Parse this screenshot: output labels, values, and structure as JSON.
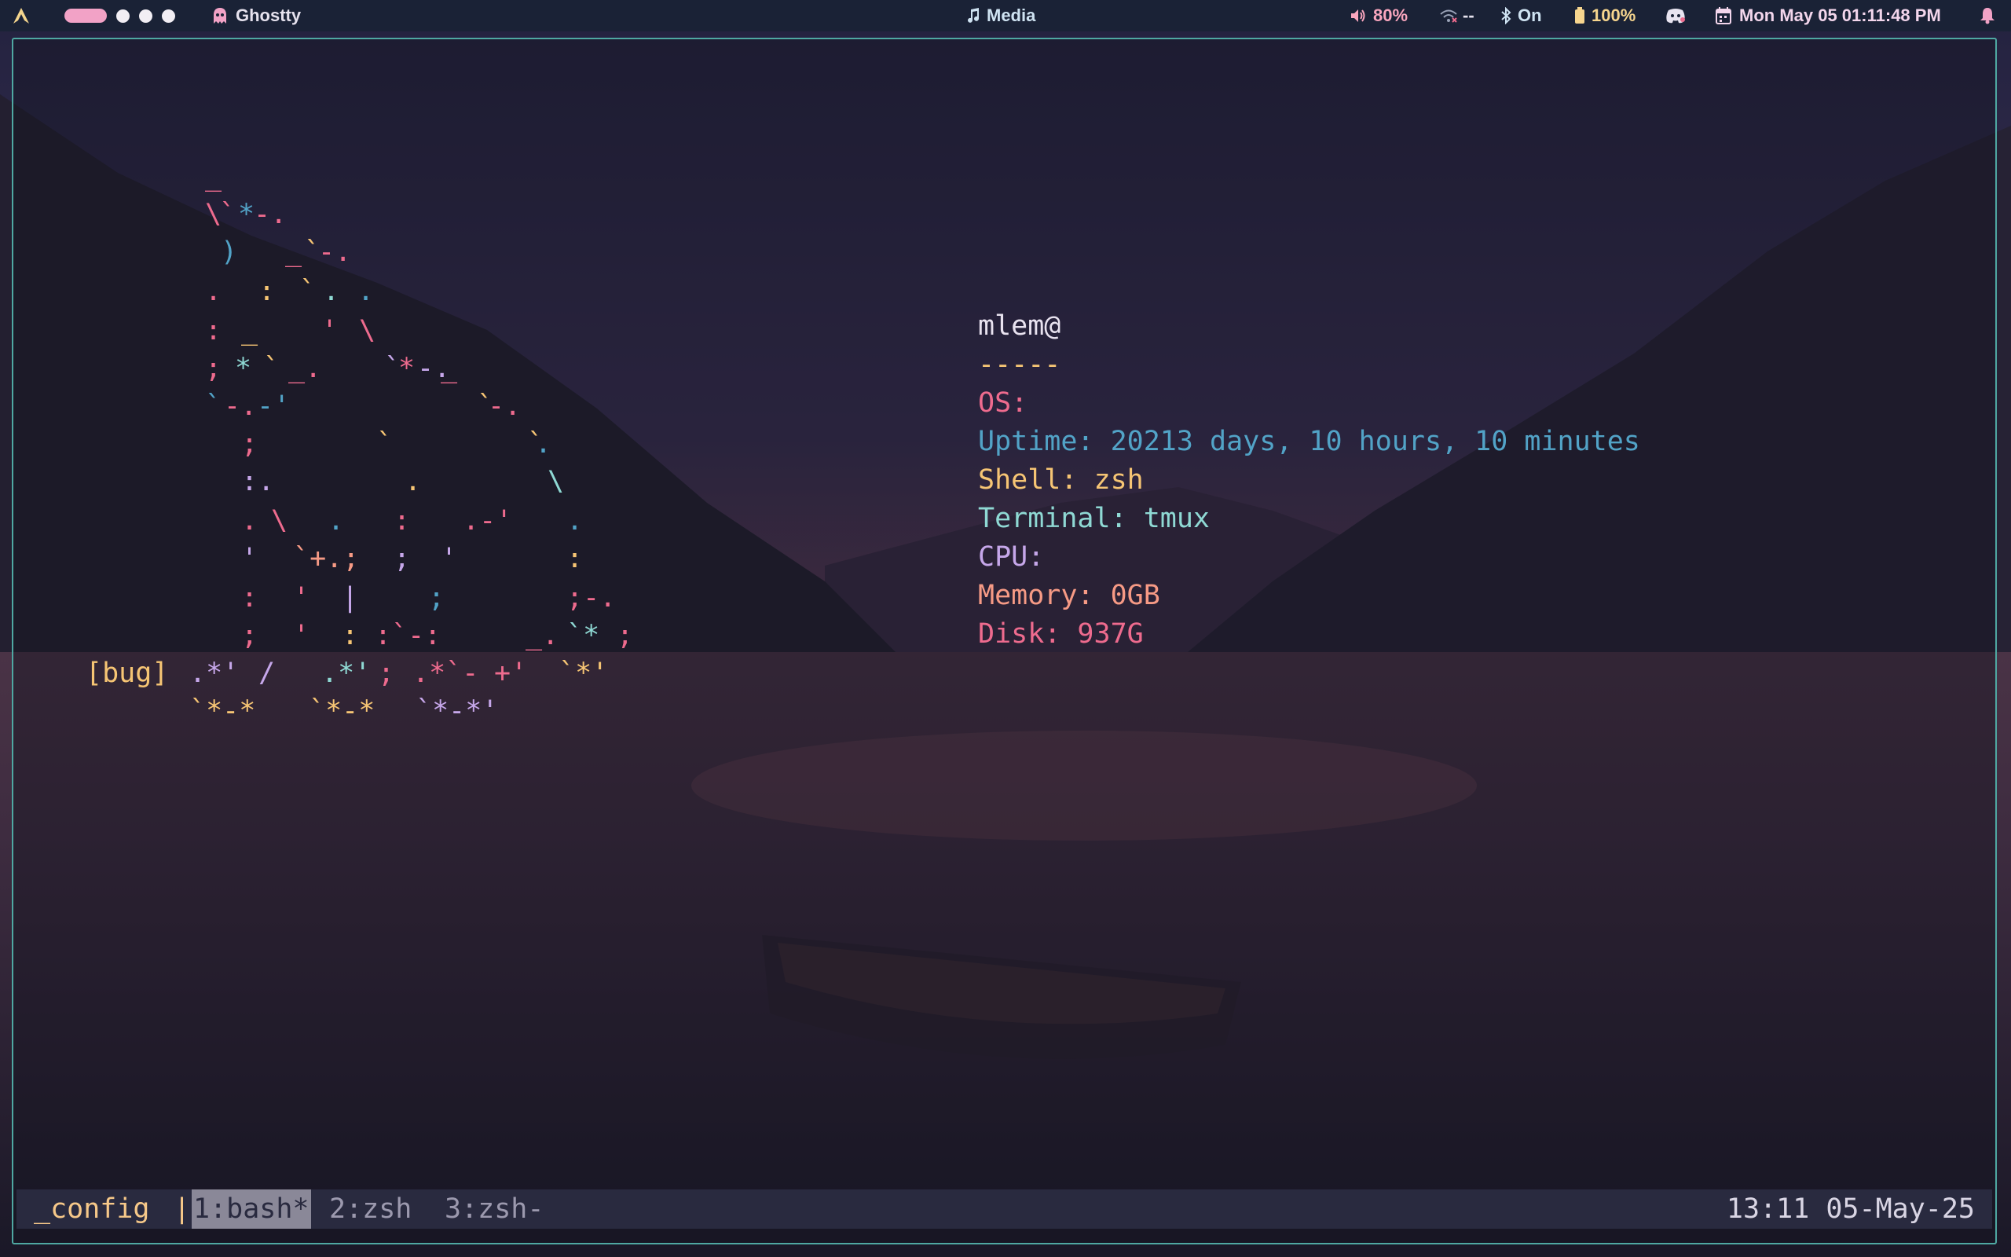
{
  "colors": {
    "accent_border": "#4fa8a2",
    "pink": "#ee6b8e",
    "cyan": "#52a3c7",
    "yellow": "#f6c574",
    "teal": "#8fd9d4",
    "lavender": "#c6a7ea",
    "peach": "#f69a85",
    "ws_active": "#f2a2c6"
  },
  "topbar": {
    "arch_icon": "arch-linux-icon",
    "window_title": "Ghostty",
    "window_icon": "ghost-icon",
    "media_label": "Media",
    "media_icon": "music-note-icon",
    "volume": "80%",
    "volume_icon": "speaker-icon",
    "network": "--",
    "network_icon": "wifi-off-icon",
    "bluetooth": "On",
    "bluetooth_icon": "bluetooth-icon",
    "battery": "100%",
    "battery_icon": "battery-icon",
    "discord_icon": "discord-icon",
    "datetime": "Mon May 05  01:11:48 PM",
    "calendar_icon": "calendar-icon",
    "bell_icon": "bell-icon"
  },
  "neofetch": {
    "user_host": "mlem@",
    "separator": "-----",
    "os": "OS:",
    "uptime": "Uptime: 20213 days, 10 hours, 10 minutes",
    "shell": "Shell: zsh",
    "terminal": "Terminal: tmux",
    "cpu": "CPU:",
    "memory": "Memory: 0GB",
    "disk": "Disk: 937G"
  },
  "ascii_art": [
    {
      "t": "_",
      "c": "pink"
    },
    {
      "t": "\\",
      "c": "pink"
    },
    {
      "t": "`",
      "c": "pink"
    },
    {
      "t": "*",
      "c": "cyan"
    },
    {
      "t": "-.",
      "c": "pink"
    },
    {
      "t": ")",
      "c": "cyan"
    },
    {
      "t": "_",
      "c": "pink"
    },
    {
      "t": "`",
      "c": "yellow"
    },
    {
      "t": "-.",
      "c": "pink"
    },
    {
      "t": ".",
      "c": "pink"
    },
    {
      "t": ":",
      "c": "yellow"
    },
    {
      "t": "`",
      "c": "yellow"
    },
    {
      "t": ".",
      "c": "teal"
    },
    {
      "t": ".",
      "c": "cyan"
    },
    {
      "t": ":",
      "c": "pink"
    },
    {
      "t": "_",
      "c": "yellow"
    },
    {
      "t": "'",
      "c": "pink"
    },
    {
      "t": "\\",
      "c": "pink"
    },
    {
      "t": ";",
      "c": "pink"
    },
    {
      "t": "*",
      "c": "teal"
    },
    {
      "t": "`",
      "c": "yellow"
    },
    {
      "t": "_.",
      "c": "pink"
    },
    {
      "t": "`",
      "c": "lavender"
    },
    {
      "t": "*",
      "c": "pink"
    },
    {
      "t": "-.",
      "c": "lavender"
    },
    {
      "t": "_",
      "c": "pink"
    },
    {
      "t": "`",
      "c": "cyan"
    },
    {
      "t": "-.",
      "c": "pink"
    },
    {
      "t": "-'",
      "c": "cyan"
    },
    {
      "t": "`",
      "c": "yellow"
    },
    {
      "t": "-.",
      "c": "pink"
    },
    {
      "t": ";",
      "c": "pink"
    },
    {
      "t": "`",
      "c": "yellow"
    },
    {
      "t": "`",
      "c": "yellow"
    },
    {
      "t": ".",
      "c": "cyan"
    },
    {
      "t": ":.",
      "c": "lavender"
    },
    {
      "t": ".",
      "c": "yellow"
    },
    {
      "t": "\\",
      "c": "teal"
    },
    {
      "t": ".",
      "c": "pink"
    },
    {
      "t": "\\",
      "c": "pink"
    },
    {
      "t": ".",
      "c": "cyan"
    },
    {
      "t": ":",
      "c": "pink"
    },
    {
      "t": ".-'",
      "c": "pink"
    },
    {
      "t": ".",
      "c": "cyan"
    },
    {
      "t": "'",
      "c": "lavender"
    },
    {
      "t": "`+.;",
      "c": "peach"
    },
    {
      "t": ";",
      "c": "lavender"
    },
    {
      "t": "'",
      "c": "lavender"
    },
    {
      "t": ":",
      "c": "yellow"
    },
    {
      "t": ":",
      "c": "pink"
    },
    {
      "t": "'",
      "c": "pink"
    },
    {
      "t": "|",
      "c": "lavender"
    },
    {
      "t": ";",
      "c": "cyan"
    },
    {
      "t": ";-.",
      "c": "pink"
    },
    {
      "t": ";",
      "c": "pink"
    },
    {
      "t": "'",
      "c": "pink"
    },
    {
      "t": ":",
      "c": "yellow"
    },
    {
      "t": ":`-:",
      "c": "pink"
    },
    {
      "t": "_.",
      "c": "pink"
    },
    {
      "t": "`*",
      "c": "teal"
    },
    {
      "t": ";",
      "c": "pink"
    },
    {
      "t": "[bug]",
      "c": "yellow"
    },
    {
      "t": ".*'",
      "c": "lavender"
    },
    {
      "t": "/",
      "c": "lavender"
    },
    {
      "t": ".*'",
      "c": "teal"
    },
    {
      "t": ";",
      "c": "pink"
    },
    {
      "t": ".*`-",
      "c": "pink"
    },
    {
      "t": "+'",
      "c": "pink"
    },
    {
      "t": "`*'",
      "c": "yellow"
    },
    {
      "t": "`*-*",
      "c": "yellow"
    },
    {
      "t": "`*-*",
      "c": "yellow"
    },
    {
      "t": "`*-*'",
      "c": "lavender"
    }
  ],
  "tmux": {
    "session": "_config",
    "separator": "|",
    "window_active": "1:bash*",
    "window_2": "2:zsh",
    "window_3": "3:zsh-",
    "clock": "13:11 05-May-25"
  }
}
